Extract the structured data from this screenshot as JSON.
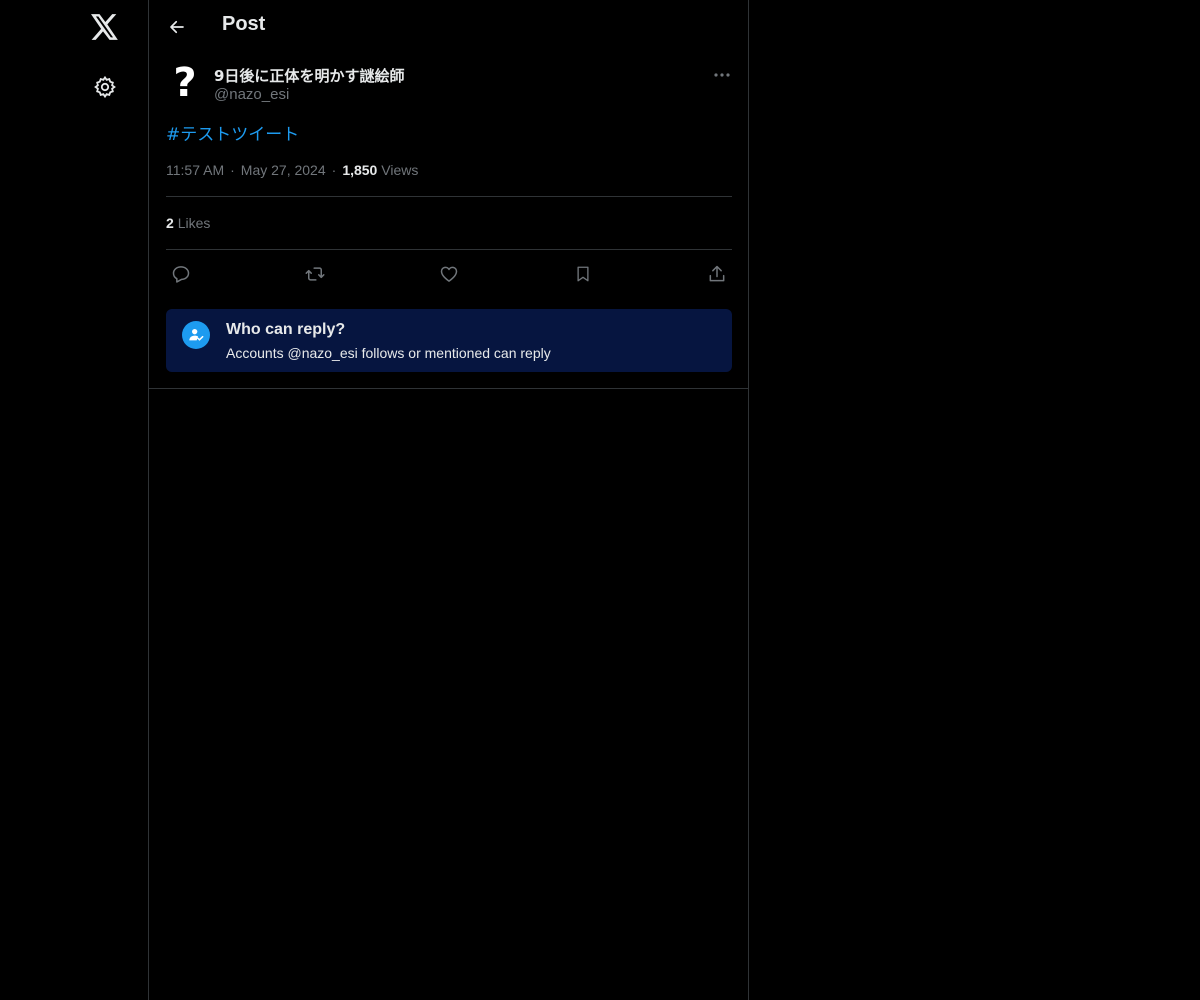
{
  "nav": {
    "logo_icon": "x-logo-icon",
    "settings_icon": "gear-icon"
  },
  "header": {
    "back_icon": "arrow-left-icon",
    "title": "Post"
  },
  "post": {
    "avatar_glyph": "?",
    "display_name": "9日後に正体を明かす謎絵師",
    "handle": "@nazo_esi",
    "more_icon": "ellipsis-icon",
    "text": "#テストツイート",
    "time": "11:57 AM",
    "date": "May 27, 2024",
    "views_count": "1,850",
    "views_label": "Views",
    "likes_count": "2",
    "likes_label": "Likes",
    "actions": [
      "reply-icon",
      "repost-icon",
      "like-icon",
      "bookmark-icon",
      "share-icon"
    ]
  },
  "reply_restriction": {
    "title": "Who can reply?",
    "description": "Accounts @nazo_esi follows or mentioned can reply"
  },
  "colors": {
    "background": "#000000",
    "accent": "#1d9bf0",
    "muted": "#71767b",
    "border": "#2f3336",
    "reply_box": "#061540"
  }
}
